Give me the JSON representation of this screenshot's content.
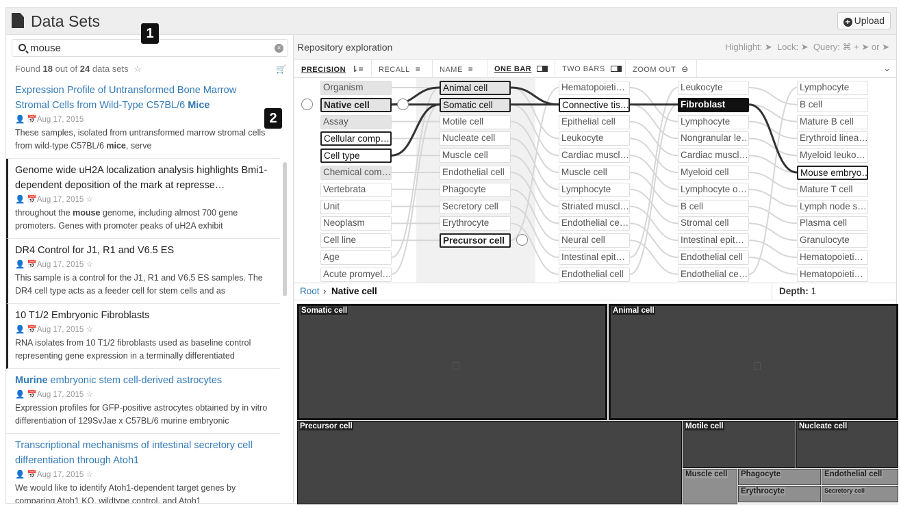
{
  "header": {
    "title": "Data Sets",
    "upload_label": "Upload"
  },
  "markers": {
    "one": "1",
    "two": "2"
  },
  "search": {
    "value": "mouse",
    "clear": "×"
  },
  "found": {
    "prefix": "Found",
    "count": "18",
    "middle": "out of",
    "total": "24",
    "suffix": "data sets"
  },
  "results": [
    {
      "title_pre": "Expression Profile of Untransformed Bone Marrow Stromal Cells from Wild-Type C57BL/6 ",
      "title_hl": "Mice",
      "title_post": "",
      "date": "Aug 17, 2015",
      "desc_pre": "These samples, isolated from untransformed marrow stromal cells from wild-type C57BL/6 ",
      "desc_hl": "mice",
      "desc_post": ", serve"
    },
    {
      "title_pre": "Genome wide uH2A localization analysis highlights Bmi1-dependent deposition of the mark at represse…",
      "title_hl": "",
      "title_post": "",
      "date": "Aug 17, 2015",
      "desc_pre": "throughout the ",
      "desc_hl": "mouse",
      "desc_post": " genome, including almost 700 gene promoters. Genes with promoter peaks of uH2A exhibit"
    },
    {
      "title_pre": "DR4 Control for J1, R1 and V6.5 ES",
      "title_hl": "",
      "title_post": "",
      "date": "Aug 17, 2015",
      "desc_pre": "This sample is a control for the J1, R1 and V6.5 ES samples. The DR4 cell type acts as a feeder cell for stem cells and as",
      "desc_hl": "",
      "desc_post": ""
    },
    {
      "title_pre": "10 T1/2 Embryonic Fibroblasts",
      "title_hl": "",
      "title_post": "",
      "date": "Aug 17, 2015",
      "desc_pre": "RNA isolates from 10 T1/2 fibroblasts used as baseline control representing gene expression in a terminally differentiated",
      "desc_hl": "",
      "desc_post": ""
    },
    {
      "title_pre": "",
      "title_hl": "Murine",
      "title_post": " embryonic stem cell-derived astrocytes",
      "date": "Aug 17, 2015",
      "desc_pre": "Expression profiles for GFP-positive astrocytes obtained by in vitro differentiation of 129SvJae x C57BL/6 murine embryonic",
      "desc_hl": "",
      "desc_post": ""
    },
    {
      "title_pre": "Transcriptional mechanisms of intestinal secretory cell differentiation through Atoh1",
      "title_hl": "",
      "title_post": "",
      "date": "Aug 17, 2015",
      "desc_pre": "We would like to identify Atoh1-dependent target genes by comparing Atoh1 KO, wildtype control, and Atoh1",
      "desc_hl": "",
      "desc_post": ""
    }
  ],
  "exploration": {
    "title": "Repository exploration",
    "highlight": "Highlight:",
    "lock": "Lock:",
    "query": "Query:",
    "query_keys": "⌘ +",
    "or": "or"
  },
  "toolbar": {
    "precision": "PRECISION",
    "recall": "RECALL",
    "name": "NAME",
    "one_bar": "ONE BAR",
    "two_bars": "TWO BARS",
    "zoom_out": "ZOOM OUT"
  },
  "columns": [
    [
      "Organism",
      "Native cell",
      "Assay",
      "Cellular comp…",
      "Cell type",
      "Chemical com…",
      "Vertebrata",
      "Unit",
      "Neoplasm",
      "Cell line",
      "Age",
      "Acute promyel…"
    ],
    [
      "Animal cell",
      "Somatic cell",
      "Motile cell",
      "Nucleate cell",
      "Muscle cell",
      "Endothelial cell",
      "Phagocyte",
      "Secretory cell",
      "Erythrocyte",
      "Precursor cell"
    ],
    [
      "Hematopoieti…",
      "Connective tis…",
      "Epithelial cell",
      "Leukocyte",
      "Cardiac muscl…",
      "Muscle cell",
      "Lymphocyte",
      "Striated muscl…",
      "Endothelial ce…",
      "Neural cell",
      "Intestinal epit…",
      "Endothelial cell"
    ],
    [
      "Leukocyte",
      "Fibroblast",
      "Lymphocyte",
      "Nongranular le…",
      "Cardiac muscl…",
      "Myeloid cell",
      "Lymphocyte o…",
      "B cell",
      "Stromal cell",
      "Intestinal epit…",
      "Endothelial cell",
      "Endothelial ce…"
    ],
    [
      "Lymphocyte",
      "B cell",
      "Mature B cell",
      "Erythroid linea…",
      "Myeloid leuko…",
      "Mouse embryo…",
      "Mature T cell",
      "Lymph node s…",
      "Plasma cell",
      "Granulocyte",
      "Hematopoieti…",
      "Hematopoieti…"
    ]
  ],
  "breadcrumb": {
    "root": "Root",
    "sep": "›",
    "current": "Native cell",
    "depth_label": "Depth:",
    "depth_value": "1"
  },
  "treemap": {
    "somatic": "Somatic cell",
    "animal": "Animal cell",
    "precursor": "Precursor cell",
    "motile": "Motile cell",
    "nucleate": "Nucleate cell",
    "muscle": "Muscle cell",
    "phagocyte": "Phagocyte",
    "endothelial": "Endothelial cell",
    "erythrocyte": "Erythrocyte",
    "secretory": "Secretory cell"
  },
  "colors": {
    "link": "#337ab7",
    "accent": "#111111"
  }
}
